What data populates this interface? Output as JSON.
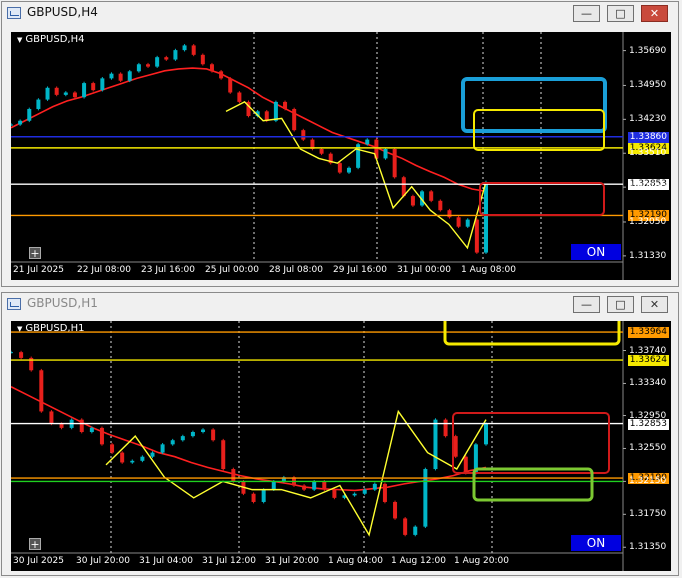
{
  "windows": [
    {
      "title": "GBPUSD,H4",
      "symbol": "GBPUSD,H4",
      "on_label": "ON",
      "plus_label": "+",
      "yrange": [
        1.312,
        1.36
      ],
      "price_ticks": [
        "1.35690",
        "1.34950",
        "1.34230",
        "1.33510",
        "1.32790",
        "1.32050",
        "1.31330"
      ],
      "price_tick_values": [
        1.3569,
        1.3495,
        1.3423,
        1.3351,
        1.3279,
        1.3205,
        1.3133
      ],
      "time_labels": [
        "21 Jul 2025",
        "22 Jul 08:00",
        "23 Jul 16:00",
        "25 Jul 00:00",
        "28 Jul 08:00",
        "29 Jul 16:00",
        "31 Jul 00:00",
        "1 Aug 08:00"
      ],
      "hlines": [
        {
          "price": 1.3386,
          "color": "#1f2de0",
          "label": "1.33860"
        },
        {
          "price": 1.33624,
          "color": "#f5e900",
          "label": "1.33624"
        },
        {
          "price": 1.32853,
          "color": "#ffffff",
          "label": "1.32853"
        },
        {
          "price": 1.3219,
          "color": "#ff9a00",
          "label": "1.32190"
        }
      ],
      "candles_close": [
        1.3412,
        1.342,
        1.3445,
        1.3465,
        1.349,
        1.3475,
        1.348,
        1.347,
        1.35,
        1.3485,
        1.351,
        1.352,
        1.3505,
        1.3525,
        1.354,
        1.3535,
        1.3555,
        1.355,
        1.357,
        1.358,
        1.356,
        1.354,
        1.3525,
        1.351,
        1.348,
        1.346,
        1.343,
        1.344,
        1.342,
        1.346,
        1.3445,
        1.34,
        1.338,
        1.336,
        1.335,
        1.333,
        1.331,
        1.332,
        1.337,
        1.338,
        1.334,
        1.336,
        1.33,
        1.326,
        1.324,
        1.327,
        1.325,
        1.323,
        1.3215,
        1.3195,
        1.321,
        1.314,
        1.329
      ],
      "ema_closes": [
        1.3405,
        1.342,
        1.3435,
        1.345,
        1.3462,
        1.347,
        1.348,
        1.349,
        1.35,
        1.351,
        1.3518,
        1.3526,
        1.353,
        1.3532,
        1.353,
        1.352,
        1.3505,
        1.349,
        1.347,
        1.3455,
        1.344,
        1.3425,
        1.341,
        1.3395,
        1.3385,
        1.3375,
        1.3365,
        1.3352,
        1.334,
        1.3325,
        1.3312,
        1.33,
        1.3285,
        1.3275,
        1.327
      ],
      "zigzag": [
        1.344,
        1.346,
        1.342,
        1.3425,
        1.336,
        1.334,
        1.333,
        1.336,
        1.335,
        1.3235,
        1.328,
        1.323,
        1.32,
        1.315,
        1.329
      ]
    },
    {
      "title": "GBPUSD,H1",
      "symbol": "GBPUSD,H1",
      "on_label": "ON",
      "plus_label": "+",
      "yrange": [
        1.3128,
        1.3405
      ],
      "price_ticks": [
        "1.33740",
        "1.33340",
        "1.32950",
        "1.32550",
        "1.32150",
        "1.31750",
        "1.31350"
      ],
      "price_tick_values": [
        1.3374,
        1.3334,
        1.3295,
        1.3255,
        1.3215,
        1.3175,
        1.3135
      ],
      "time_labels": [
        "30 Jul 2025",
        "30 Jul 20:00",
        "31 Jul 04:00",
        "31 Jul 12:00",
        "31 Jul 20:00",
        "1 Aug 04:00",
        "1 Aug 12:00",
        "1 Aug 20:00"
      ],
      "hlines": [
        {
          "price": 1.33964,
          "color": "#ff9a00",
          "label": "1.33964"
        },
        {
          "price": 1.33624,
          "color": "#f5e900",
          "label": "1.33624"
        },
        {
          "price": 1.32853,
          "color": "#ffffff",
          "label": "1.32853"
        },
        {
          "price": 1.3219,
          "color": "#ff9a00",
          "label": "1.32190"
        },
        {
          "price": 1.3215,
          "color": "#1fd01f",
          "label": ""
        }
      ],
      "candles_close": [
        1.3372,
        1.3365,
        1.335,
        1.33,
        1.3285,
        1.328,
        1.329,
        1.3275,
        1.328,
        1.326,
        1.325,
        1.3238,
        1.324,
        1.3245,
        1.325,
        1.326,
        1.3265,
        1.327,
        1.3275,
        1.3278,
        1.3265,
        1.323,
        1.3215,
        1.32,
        1.319,
        1.3205,
        1.3215,
        1.322,
        1.321,
        1.3205,
        1.3215,
        1.3205,
        1.3195,
        1.3198,
        1.32,
        1.3205,
        1.3212,
        1.319,
        1.317,
        1.315,
        1.316,
        1.323,
        1.329,
        1.327,
        1.3245,
        1.3225,
        1.326,
        1.3285
      ],
      "ema_closes": [
        1.333,
        1.332,
        1.331,
        1.33,
        1.329,
        1.328,
        1.3272,
        1.3265,
        1.3258,
        1.325,
        1.3245,
        1.3238,
        1.3232,
        1.3227,
        1.3222,
        1.3218,
        1.3215,
        1.3212,
        1.3208,
        1.3206,
        1.3205,
        1.3204,
        1.3206,
        1.3208,
        1.3212,
        1.3215,
        1.3218,
        1.3222,
        1.3228,
        1.3232
      ],
      "zigzag": [
        1.3235,
        1.327,
        1.322,
        1.3195,
        1.3215,
        1.3205,
        1.3205,
        1.3195,
        1.321,
        1.315,
        1.33,
        1.325,
        1.323,
        1.329
      ]
    }
  ]
}
